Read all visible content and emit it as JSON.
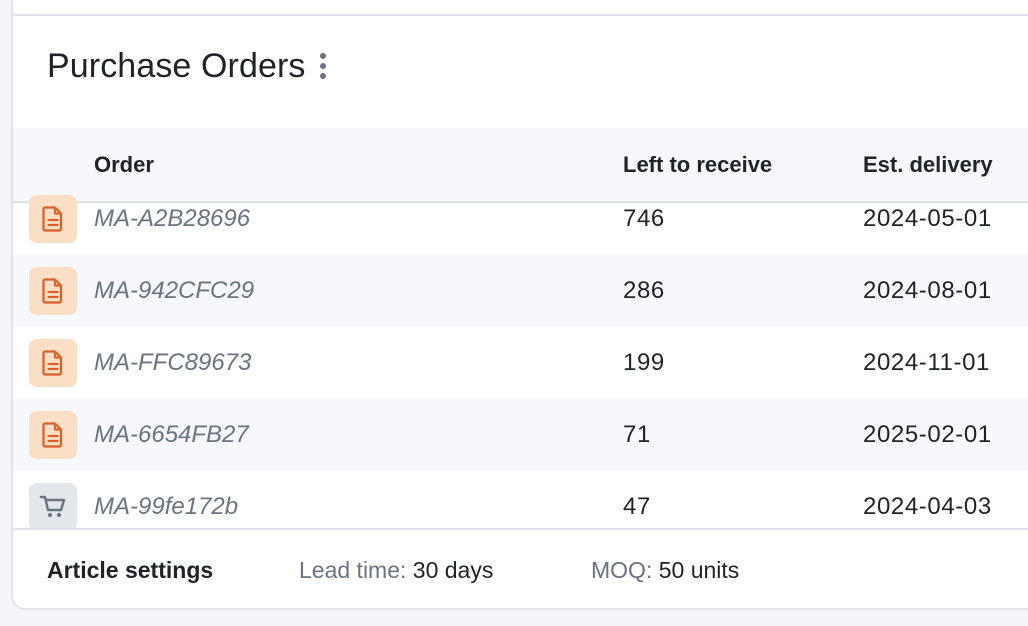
{
  "panel": {
    "title": "Purchase Orders",
    "menu_icon": "kebab-vertical-icon"
  },
  "table": {
    "columns": [
      "Order",
      "Left to receive",
      "Est. delivery"
    ],
    "rows": [
      {
        "icon": "document-icon",
        "order": "MA-A2B28696",
        "left": "746",
        "delivery": "2024-05-01"
      },
      {
        "icon": "document-icon",
        "order": "MA-942CFC29",
        "left": "286",
        "delivery": "2024-08-01"
      },
      {
        "icon": "document-icon",
        "order": "MA-FFC89673",
        "left": "199",
        "delivery": "2024-11-01"
      },
      {
        "icon": "document-icon",
        "order": "MA-6654FB27",
        "left": "71",
        "delivery": "2025-02-01"
      },
      {
        "icon": "cart-icon",
        "order": "MA-99fe172b",
        "left": "47",
        "delivery": "2024-04-03"
      }
    ]
  },
  "footer": {
    "label": "Article settings",
    "lead_time_label": "Lead time:",
    "lead_time_value": "30 days",
    "moq_label": "MOQ:",
    "moq_value": "50 units"
  },
  "colors": {
    "document_icon_bg": "#f8dfc6",
    "document_icon_fg": "#d9622b",
    "cart_icon_bg": "#e3e6ea",
    "cart_icon_fg": "#6b7280"
  }
}
